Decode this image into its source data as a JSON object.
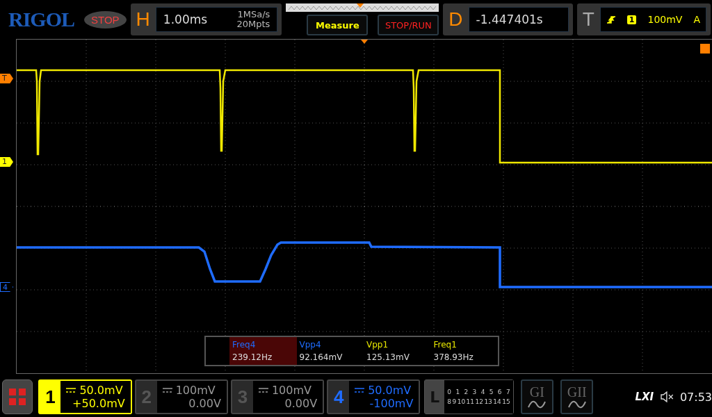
{
  "brand": "RIGOL",
  "run_state": "STOP",
  "horizontal": {
    "label": "H",
    "timebase": "1.00ms",
    "sample_rate": "1MSa/s",
    "memory_depth": "20Mpts"
  },
  "measure_button": "Measure",
  "stop_run_button": "STOP/RUN",
  "delay": {
    "label": "D",
    "value": "-1.447401s"
  },
  "trigger": {
    "label": "T",
    "source": "1",
    "threshold": "100mV",
    "mode": "A"
  },
  "trace_markers": [
    {
      "label": "T",
      "color": "#ff7f00"
    },
    {
      "label": "1",
      "color": "#ffff00"
    },
    {
      "label": "4",
      "color": "#1f6cff"
    }
  ],
  "measurements": [
    {
      "name": "Freq4",
      "value": "239.12Hz",
      "color": "#1f6cff",
      "selected": true
    },
    {
      "name": "Vpp4",
      "value": "92.164mV",
      "color": "#1f6cff",
      "selected": false
    },
    {
      "name": "Vpp1",
      "value": "125.13mV",
      "color": "#e8e800",
      "selected": false
    },
    {
      "name": "Freq1",
      "value": "378.93Hz",
      "color": "#e8e800",
      "selected": false
    }
  ],
  "channels": [
    {
      "number": "1",
      "scale": "50.0mV",
      "offset": "+50.0mV",
      "on": true,
      "selected": true,
      "color": "#ffff00"
    },
    {
      "number": "2",
      "scale": "100mV",
      "offset": "0.00V",
      "on": false,
      "selected": false
    },
    {
      "number": "3",
      "scale": "100mV",
      "offset": "0.00V",
      "on": false,
      "selected": false
    },
    {
      "number": "4",
      "scale": "50.0mV",
      "offset": "-100mV",
      "on": true,
      "selected": false,
      "color": "#1f6cff"
    }
  ],
  "logic": {
    "label": "L",
    "row_1": [
      "0",
      "1",
      "2",
      "3",
      "4",
      "5",
      "6",
      "7"
    ],
    "row_2": [
      "8",
      "9",
      "10",
      "11",
      "12",
      "13",
      "14",
      "15"
    ]
  },
  "generators": [
    {
      "label": "GI"
    },
    {
      "label": "GII"
    }
  ],
  "status": {
    "lxi": "LXI",
    "time": "07:53"
  }
}
